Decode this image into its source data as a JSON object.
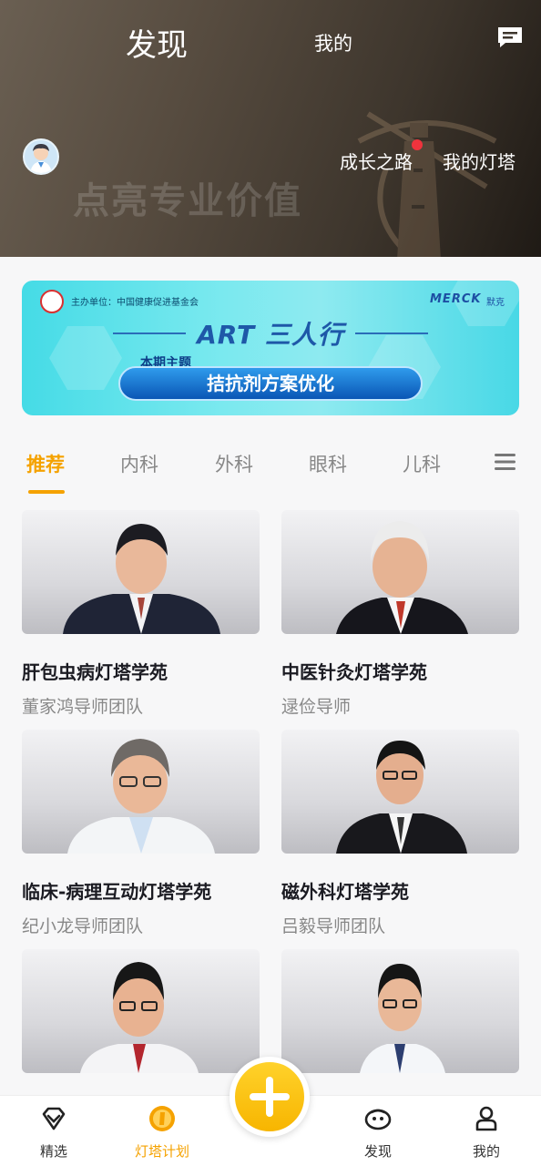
{
  "header": {
    "tabs": [
      {
        "label": "发现",
        "active": true
      },
      {
        "label": "我的",
        "active": false
      }
    ],
    "slogan": "点亮专业价值",
    "links": {
      "growth": "成长之路",
      "my_tower": "我的灯塔"
    },
    "growth_has_red_dot": true,
    "icons": {
      "message": "message-icon",
      "avatar": "user-avatar"
    }
  },
  "banner": {
    "sponsor": "主办单位：中国健康促进基金会",
    "brand": "MERCK",
    "brand_cn": "默克",
    "title": "ART 三人行",
    "topic_label": "本期主题",
    "topic": "拮抗剂方案优化"
  },
  "categories": {
    "items": [
      "推荐",
      "内科",
      "外科",
      "眼科",
      "儿科"
    ],
    "active_index": 0,
    "menu_icon": "menu-icon"
  },
  "cards": [
    {
      "title": "肝包虫病灯塔学苑",
      "subtitle": "董家鸿导师团队"
    },
    {
      "title": "中医针灸灯塔学苑",
      "subtitle": "逯俭导师"
    },
    {
      "title": "临床-病理互动灯塔学苑",
      "subtitle": "纪小龙导师团队"
    },
    {
      "title": "磁外科灯塔学苑",
      "subtitle": "吕毅导师团队"
    },
    {
      "title": "",
      "subtitle": ""
    },
    {
      "title": "",
      "subtitle": ""
    }
  ],
  "bottom_nav": [
    {
      "label": "精选",
      "icon": "diamond-icon",
      "active": false
    },
    {
      "label": "灯塔计划",
      "icon": "lighthouse-coin-icon",
      "active": true
    },
    {
      "label": "发现",
      "icon": "discover-face-icon",
      "active": false
    },
    {
      "label": "我的",
      "icon": "profile-icon",
      "active": false
    }
  ],
  "fab": {
    "icon": "plus-icon"
  },
  "colors": {
    "accent": "#f5a200",
    "header_dark": "#3d352c",
    "banner_cyan": "#45dbe6"
  }
}
